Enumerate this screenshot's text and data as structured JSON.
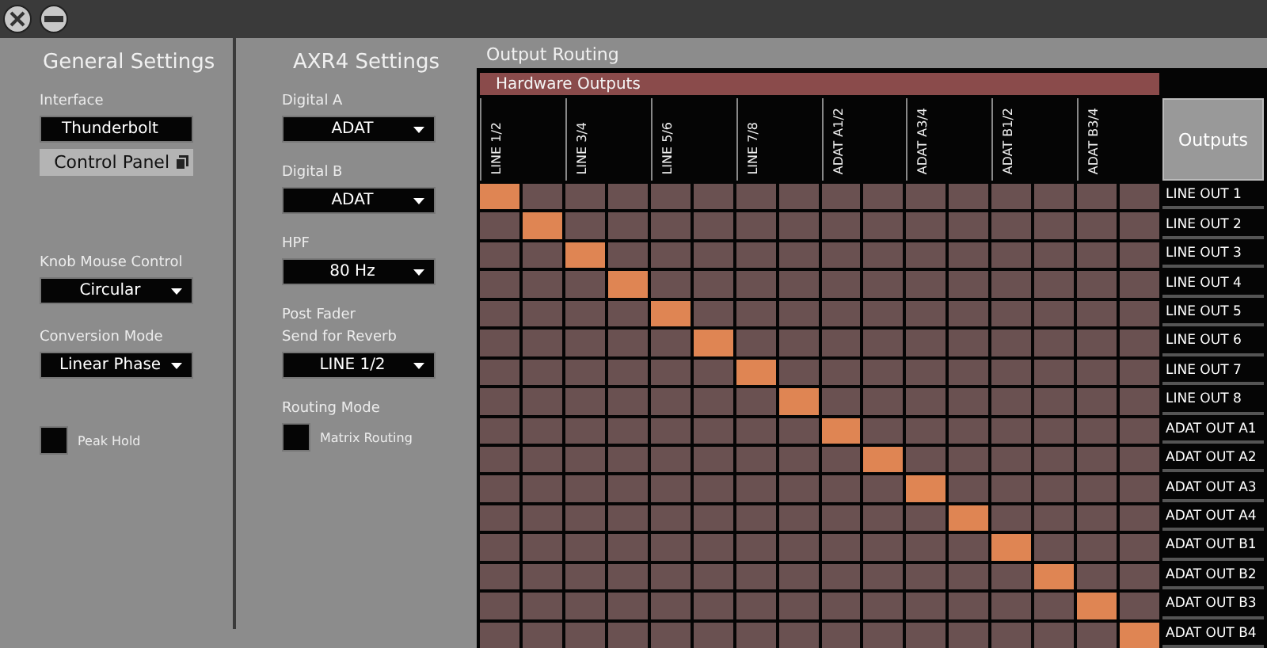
{
  "window": {
    "buttons": [
      {
        "kind": "close"
      },
      {
        "kind": "minimize"
      }
    ]
  },
  "general_settings": {
    "title": "General Settings",
    "interface": {
      "label": "Interface",
      "value": "Thunderbolt",
      "button": "Control Panel"
    },
    "knob_mouse_control": {
      "label": "Knob Mouse Control",
      "value": "Circular"
    },
    "conversion_mode": {
      "label": "Conversion Mode",
      "value": "Linear Phase"
    },
    "peak_hold": {
      "label": "Peak Hold",
      "checked": false
    }
  },
  "axr4_settings": {
    "title": "AXR4 Settings",
    "dropdowns": [
      {
        "label": "Digital A",
        "value": "ADAT"
      },
      {
        "label": "Digital B",
        "value": "ADAT"
      },
      {
        "label": "HPF",
        "value": "80 Hz"
      },
      {
        "label": "Post Fader\nSend for Reverb",
        "value": "LINE 1/2"
      }
    ],
    "routing_mode": {
      "label": "Routing Mode",
      "option": "Matrix Routing",
      "checked": false
    }
  },
  "output_routing": {
    "title": "Output Routing",
    "header": "Hardware Outputs",
    "outputs_button": "Outputs",
    "columns": [
      "LINE 1/2",
      "LINE 3/4",
      "LINE 5/6",
      "LINE 7/8",
      "ADAT A1/2",
      "ADAT A3/4",
      "ADAT B1/2",
      "ADAT B3/4"
    ],
    "rows": [
      {
        "label": "LINE OUT 1",
        "cells": [
          true,
          false,
          false,
          false,
          false,
          false,
          false,
          false,
          false,
          false,
          false,
          false,
          false,
          false,
          false,
          false
        ]
      },
      {
        "label": "LINE OUT 2",
        "cells": [
          false,
          true,
          false,
          false,
          false,
          false,
          false,
          false,
          false,
          false,
          false,
          false,
          false,
          false,
          false,
          false
        ]
      },
      {
        "label": "LINE OUT 3",
        "cells": [
          false,
          false,
          true,
          false,
          false,
          false,
          false,
          false,
          false,
          false,
          false,
          false,
          false,
          false,
          false,
          false
        ]
      },
      {
        "label": "LINE OUT 4",
        "cells": [
          false,
          false,
          false,
          true,
          false,
          false,
          false,
          false,
          false,
          false,
          false,
          false,
          false,
          false,
          false,
          false
        ]
      },
      {
        "label": "LINE OUT 5",
        "cells": [
          false,
          false,
          false,
          false,
          true,
          false,
          false,
          false,
          false,
          false,
          false,
          false,
          false,
          false,
          false,
          false
        ]
      },
      {
        "label": "LINE OUT 6",
        "cells": [
          false,
          false,
          false,
          false,
          false,
          true,
          false,
          false,
          false,
          false,
          false,
          false,
          false,
          false,
          false,
          false
        ]
      },
      {
        "label": "LINE OUT 7",
        "cells": [
          false,
          false,
          false,
          false,
          false,
          false,
          true,
          false,
          false,
          false,
          false,
          false,
          false,
          false,
          false,
          false
        ]
      },
      {
        "label": "LINE OUT 8",
        "cells": [
          false,
          false,
          false,
          false,
          false,
          false,
          false,
          true,
          false,
          false,
          false,
          false,
          false,
          false,
          false,
          false
        ]
      },
      {
        "label": "ADAT OUT A1",
        "cells": [
          false,
          false,
          false,
          false,
          false,
          false,
          false,
          false,
          true,
          false,
          false,
          false,
          false,
          false,
          false,
          false
        ]
      },
      {
        "label": "ADAT OUT A2",
        "cells": [
          false,
          false,
          false,
          false,
          false,
          false,
          false,
          false,
          false,
          true,
          false,
          false,
          false,
          false,
          false,
          false
        ]
      },
      {
        "label": "ADAT OUT A3",
        "cells": [
          false,
          false,
          false,
          false,
          false,
          false,
          false,
          false,
          false,
          false,
          true,
          false,
          false,
          false,
          false,
          false
        ]
      },
      {
        "label": "ADAT OUT A4",
        "cells": [
          false,
          false,
          false,
          false,
          false,
          false,
          false,
          false,
          false,
          false,
          false,
          true,
          false,
          false,
          false,
          false
        ]
      },
      {
        "label": "ADAT OUT B1",
        "cells": [
          false,
          false,
          false,
          false,
          false,
          false,
          false,
          false,
          false,
          false,
          false,
          false,
          true,
          false,
          false,
          false
        ]
      },
      {
        "label": "ADAT OUT B2",
        "cells": [
          false,
          false,
          false,
          false,
          false,
          false,
          false,
          false,
          false,
          false,
          false,
          false,
          false,
          true,
          false,
          false
        ]
      },
      {
        "label": "ADAT OUT B3",
        "cells": [
          false,
          false,
          false,
          false,
          false,
          false,
          false,
          false,
          false,
          false,
          false,
          false,
          false,
          false,
          true,
          false
        ]
      },
      {
        "label": "ADAT OUT B4",
        "cells": [
          false,
          false,
          false,
          false,
          false,
          false,
          false,
          false,
          false,
          false,
          false,
          false,
          false,
          false,
          false,
          true
        ]
      }
    ]
  }
}
